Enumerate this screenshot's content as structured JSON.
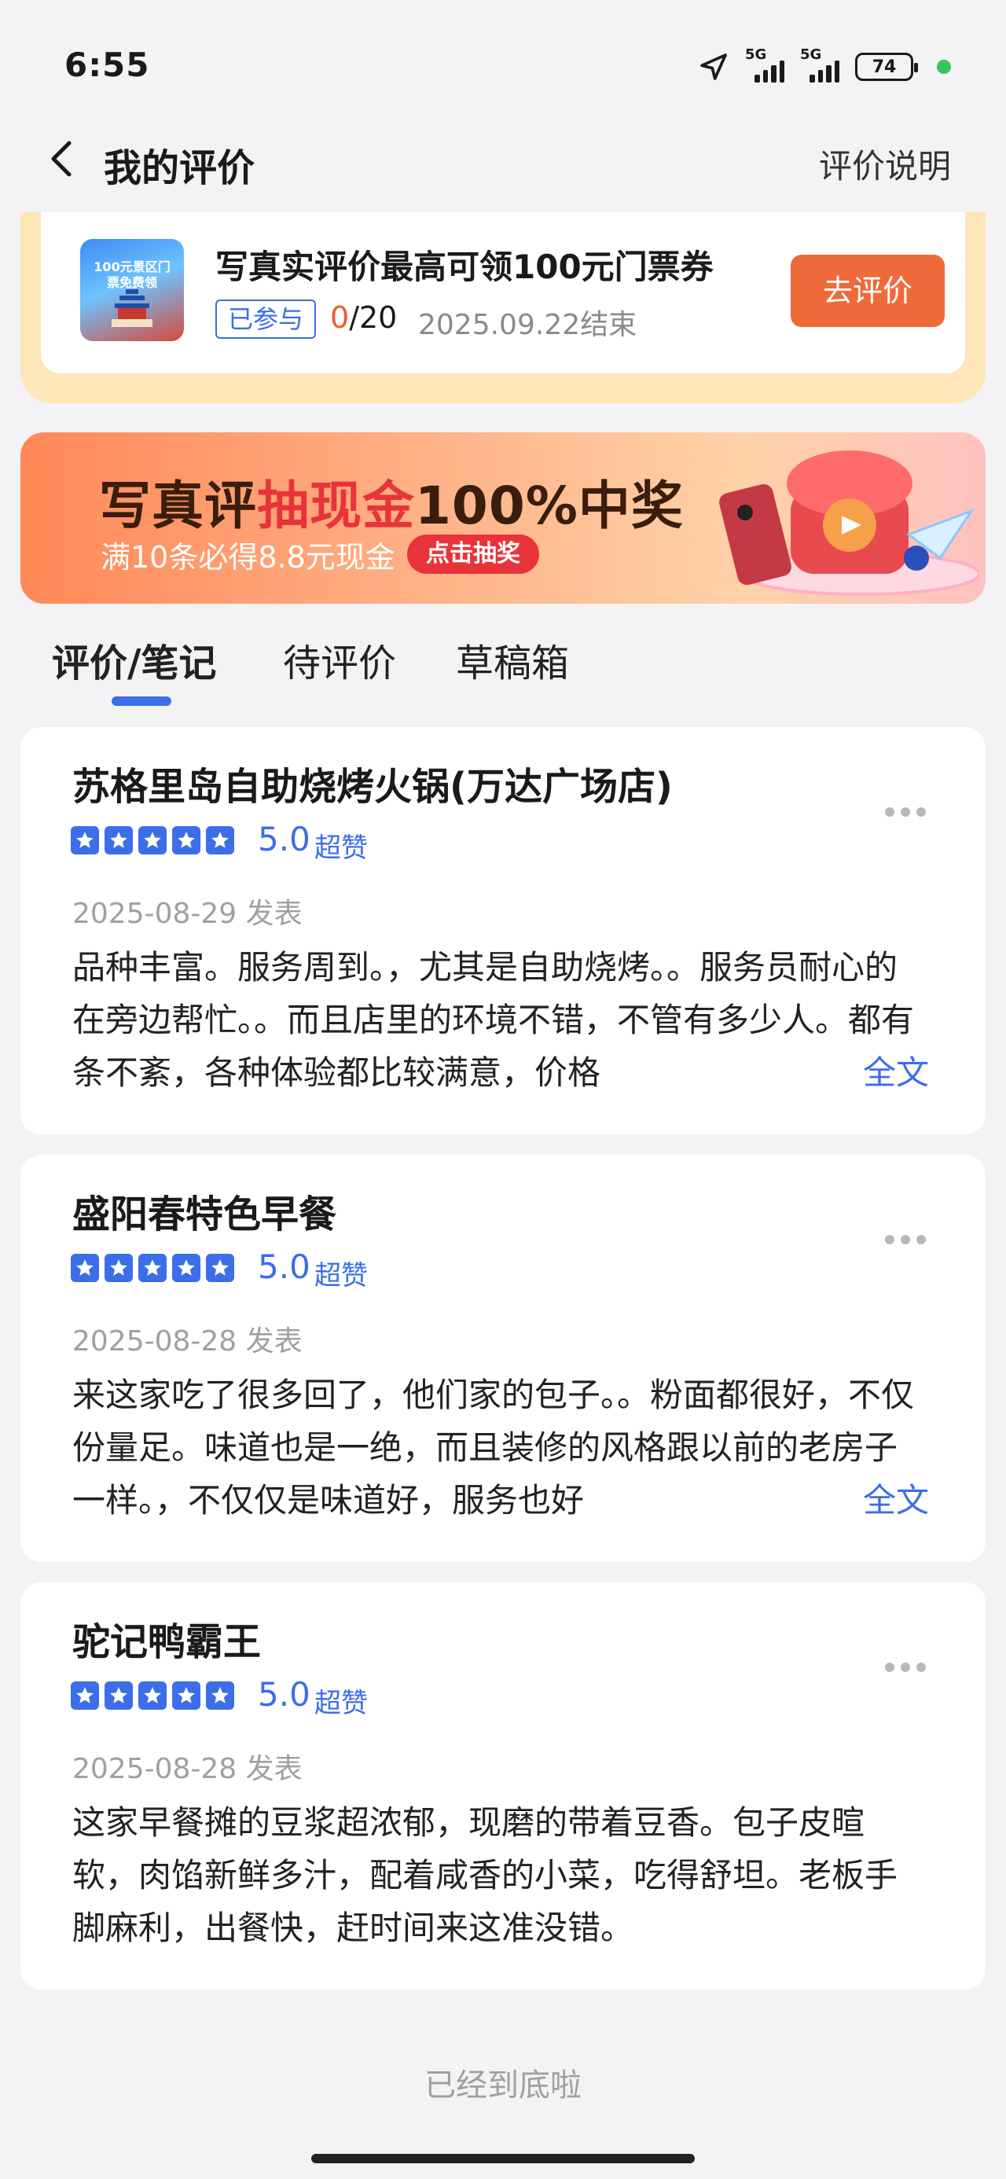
{
  "status_bar": {
    "time": "6:55",
    "net1": "5G",
    "net2": "5G",
    "battery": "74"
  },
  "nav": {
    "title": "我的评价",
    "help": "评价说明"
  },
  "activity": {
    "thumb_text": "100元景区门票免费领",
    "title": "写真实评价最高可领100元门票券",
    "joined_label": "已参与",
    "progress_current": "0",
    "progress_total": "/20",
    "end_date": "2025.09.22结束",
    "button_label": "去评价"
  },
  "banner": {
    "title_part1": "写真评",
    "title_highlight": "抽现金",
    "title_part2": "100%中奖",
    "subtitle": "满10条必得8.8元现金",
    "cta": "点击抽奖"
  },
  "tabs": [
    {
      "label": "评价/笔记",
      "active": true
    },
    {
      "label": "待评价",
      "active": false
    },
    {
      "label": "草稿箱",
      "active": false
    }
  ],
  "reviews": [
    {
      "shop": "苏格里岛自助烧烤火锅(万达广场店)",
      "rating": 5,
      "score": "5.0",
      "score_word": "超赞",
      "date": "2025-08-29 发表",
      "text": "品种丰富。服务周到。，尤其是自助烧烤。。服务员耐心的在旁边帮忙。。而且店里的环境不错，不管有多少人。都有条不紊，各种体验都比较满意，价格",
      "read_all": "全文"
    },
    {
      "shop": "盛阳春特色早餐",
      "rating": 5,
      "score": "5.0",
      "score_word": "超赞",
      "date": "2025-08-28 发表",
      "text": "来这家吃了很多回了，他们家的包子。。粉面都很好，不仅份量足。味道也是一绝，而且装修的风格跟以前的老房子一样。，不仅仅是味道好，服务也好",
      "read_all": "全文"
    },
    {
      "shop": "驼记鸭霸王",
      "rating": 5,
      "score": "5.0",
      "score_word": "超赞",
      "date": "2025-08-28 发表",
      "text": "这家早餐摊的豆浆超浓郁，现磨的带着豆香。包子皮暄软，肉馅新鲜多汁，配着咸香的小菜，吃得舒坦。老板手脚麻利，出餐快，赶时间来这准没错。",
      "read_all": ""
    }
  ],
  "footer": "已经到底啦",
  "colors": {
    "accent": "#3b6ee8",
    "orange": "#ef6a3a",
    "red": "#e8333a"
  }
}
